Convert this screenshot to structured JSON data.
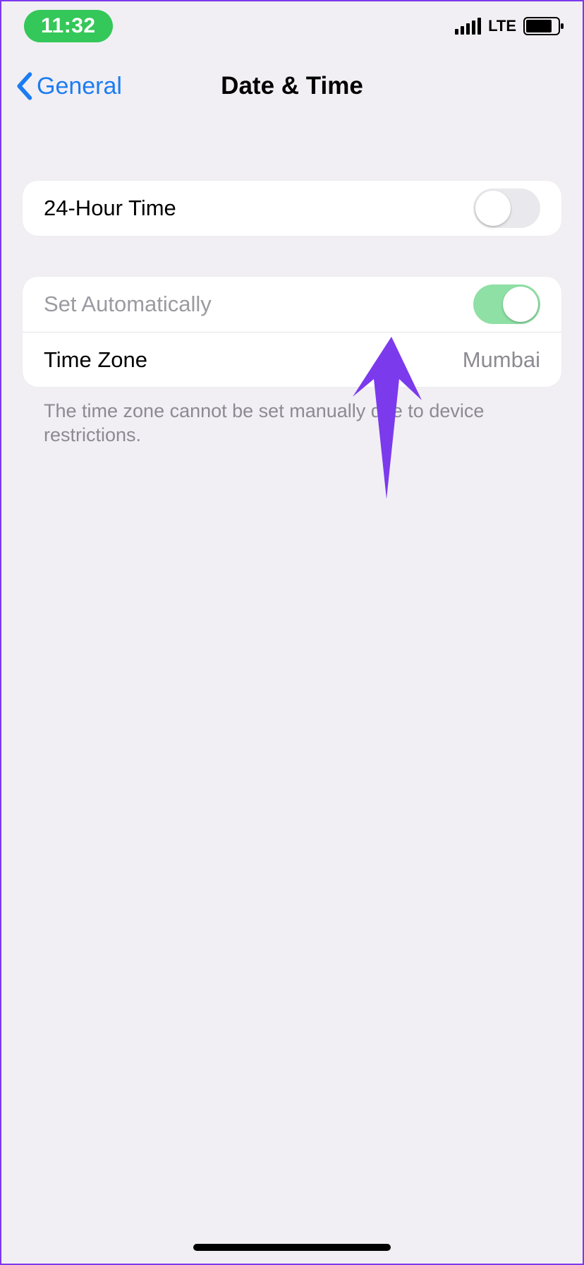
{
  "status_bar": {
    "time": "11:32",
    "network": "LTE"
  },
  "nav": {
    "back_label": "General",
    "title": "Date & Time"
  },
  "settings": {
    "twenty_four_hour": {
      "label": "24-Hour Time",
      "enabled": false
    },
    "set_automatically": {
      "label": "Set Automatically",
      "enabled": true
    },
    "time_zone": {
      "label": "Time Zone",
      "value": "Mumbai"
    }
  },
  "footer_note": "The time zone cannot be set manually due to device restrictions.",
  "colors": {
    "accent_blue": "#1c7cf2",
    "toggle_on": "#8fe0a5",
    "time_pill": "#34c759",
    "annotation_arrow": "#7c3aed"
  }
}
